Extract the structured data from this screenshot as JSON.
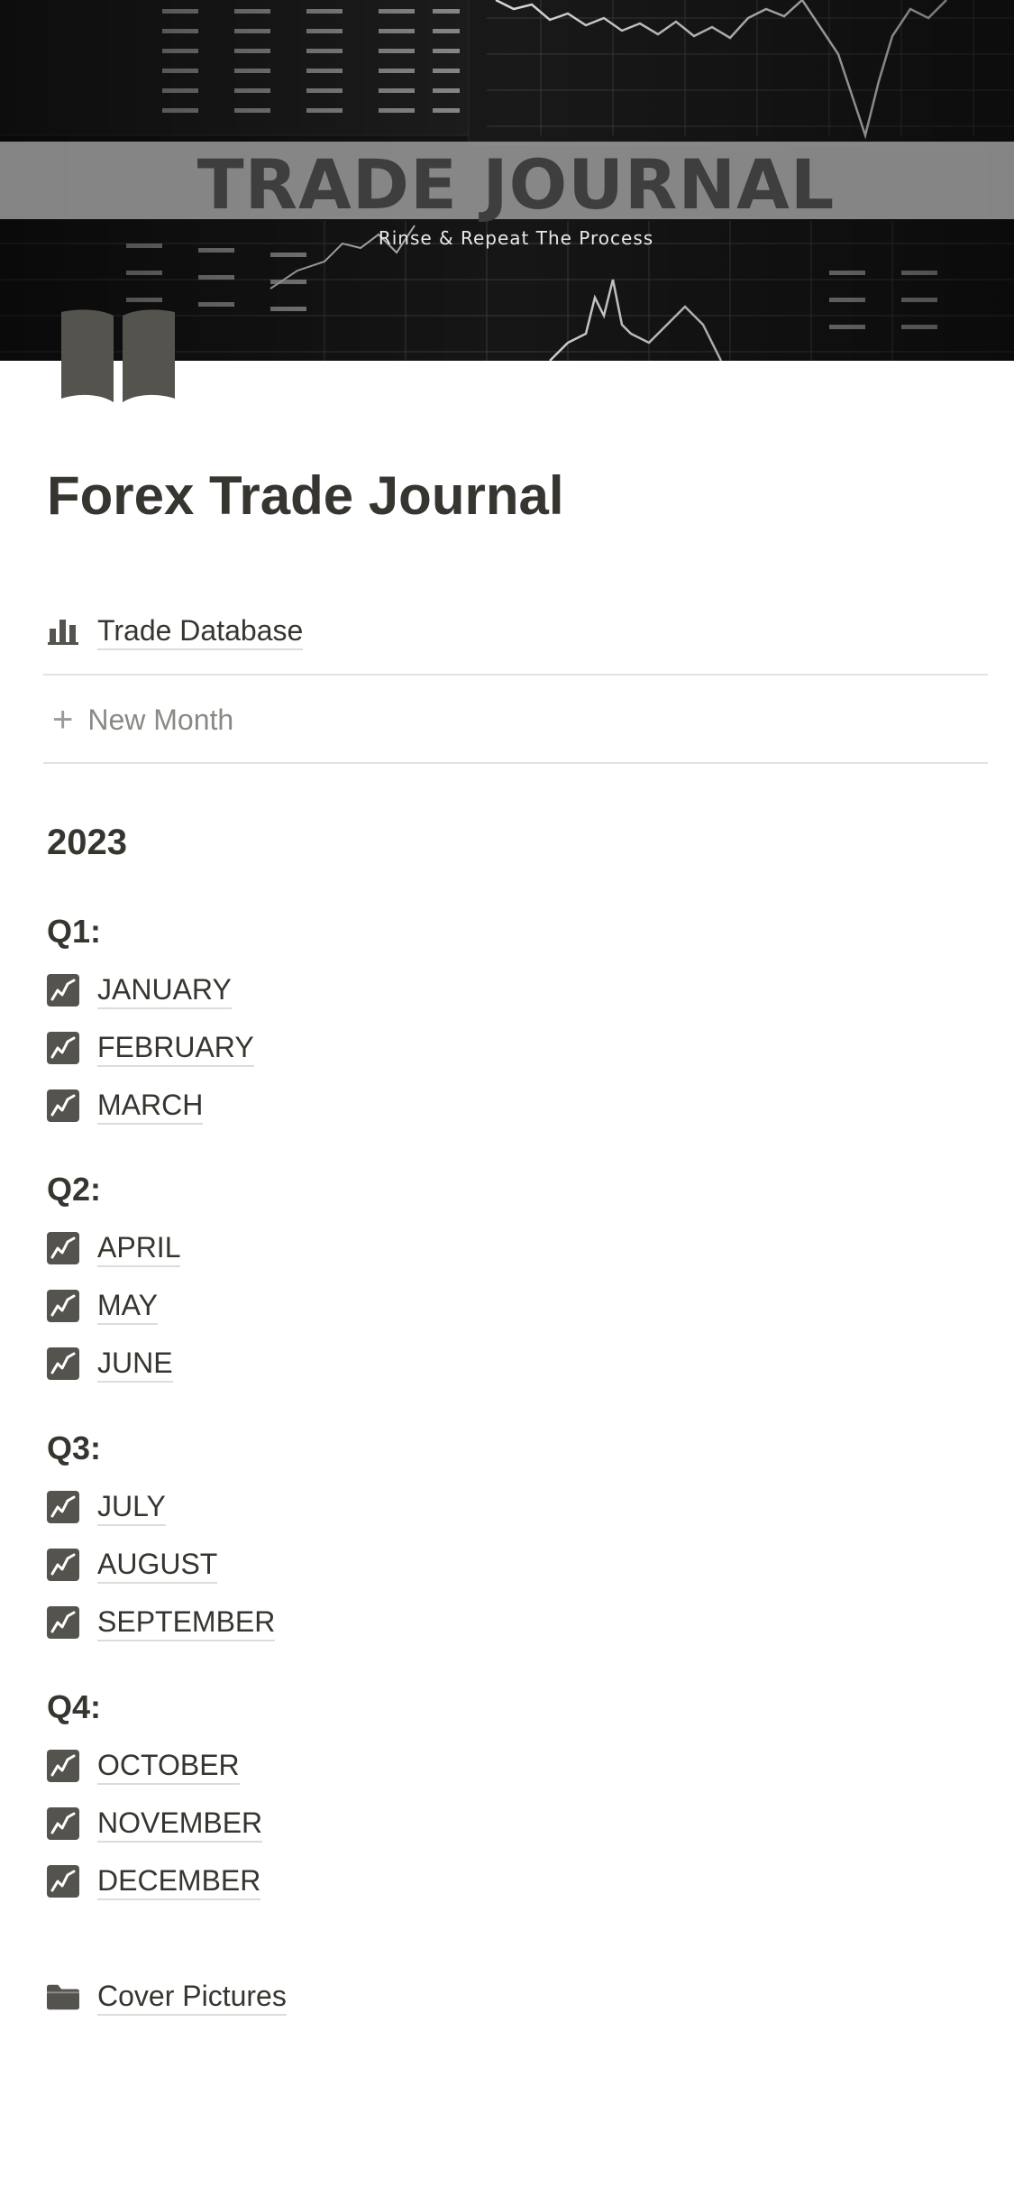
{
  "cover": {
    "title": "TRADE JOURNAL",
    "subtitle": "Rinse & Repeat The Process"
  },
  "page": {
    "icon": "open-book-icon",
    "title": "Forex Trade Journal"
  },
  "database_link": {
    "icon": "bar-chart-icon",
    "label": "Trade Database"
  },
  "new_month": {
    "label": "New Month"
  },
  "year": "2023",
  "quarters": [
    {
      "label": "Q1:",
      "months": [
        "JANUARY",
        "FEBRUARY",
        "MARCH"
      ]
    },
    {
      "label": "Q2:",
      "months": [
        "APRIL",
        "MAY",
        "JUNE"
      ]
    },
    {
      "label": "Q3:",
      "months": [
        "JULY",
        "AUGUST",
        "SEPTEMBER"
      ]
    },
    {
      "label": "Q4:",
      "months": [
        "OCTOBER",
        "NOVEMBER",
        "DECEMBER"
      ]
    }
  ],
  "month_icon": "chart-increasing-icon",
  "cover_pictures": {
    "icon": "folder-icon",
    "label": "Cover Pictures"
  },
  "colors": {
    "text": "#37352f",
    "icon": "#55534e",
    "muted": "#8a8984",
    "divider": "#e3e2df"
  }
}
